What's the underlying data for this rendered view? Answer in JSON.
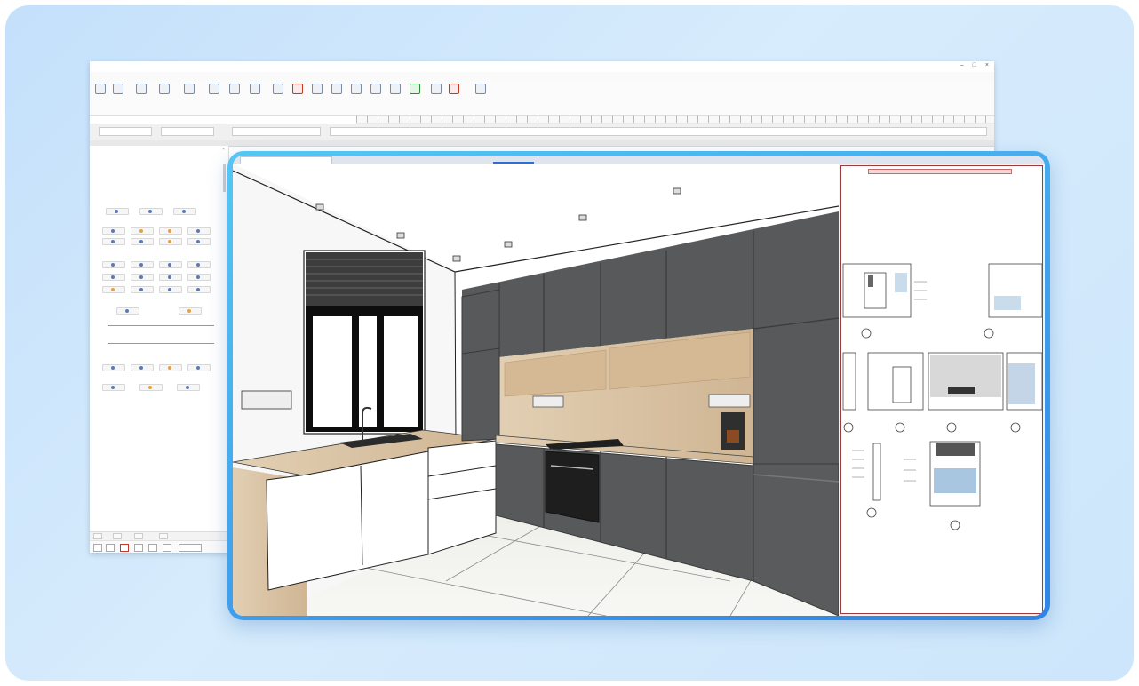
{
  "app": {
    "window_title": "",
    "search_placeholder": "",
    "menu": [],
    "ribbon_groups": [],
    "panel_title": "",
    "panel_sections": [],
    "panel_items": [],
    "bottom_tabs": []
  },
  "viewport": {
    "tabs": [],
    "view_label": "",
    "sheet_title": ""
  },
  "colors": {
    "card_gradient_start": "#56c6f4",
    "card_gradient_end": "#2f84e6",
    "background": "#cde6fb",
    "cabinet_gray": "#58595b",
    "wood": "#d8c2a4",
    "sheet_border": "#9c3b3b"
  },
  "icons": [
    "window-close-icon",
    "window-minimize-icon",
    "window-maximize-icon",
    "status-online-icon"
  ]
}
